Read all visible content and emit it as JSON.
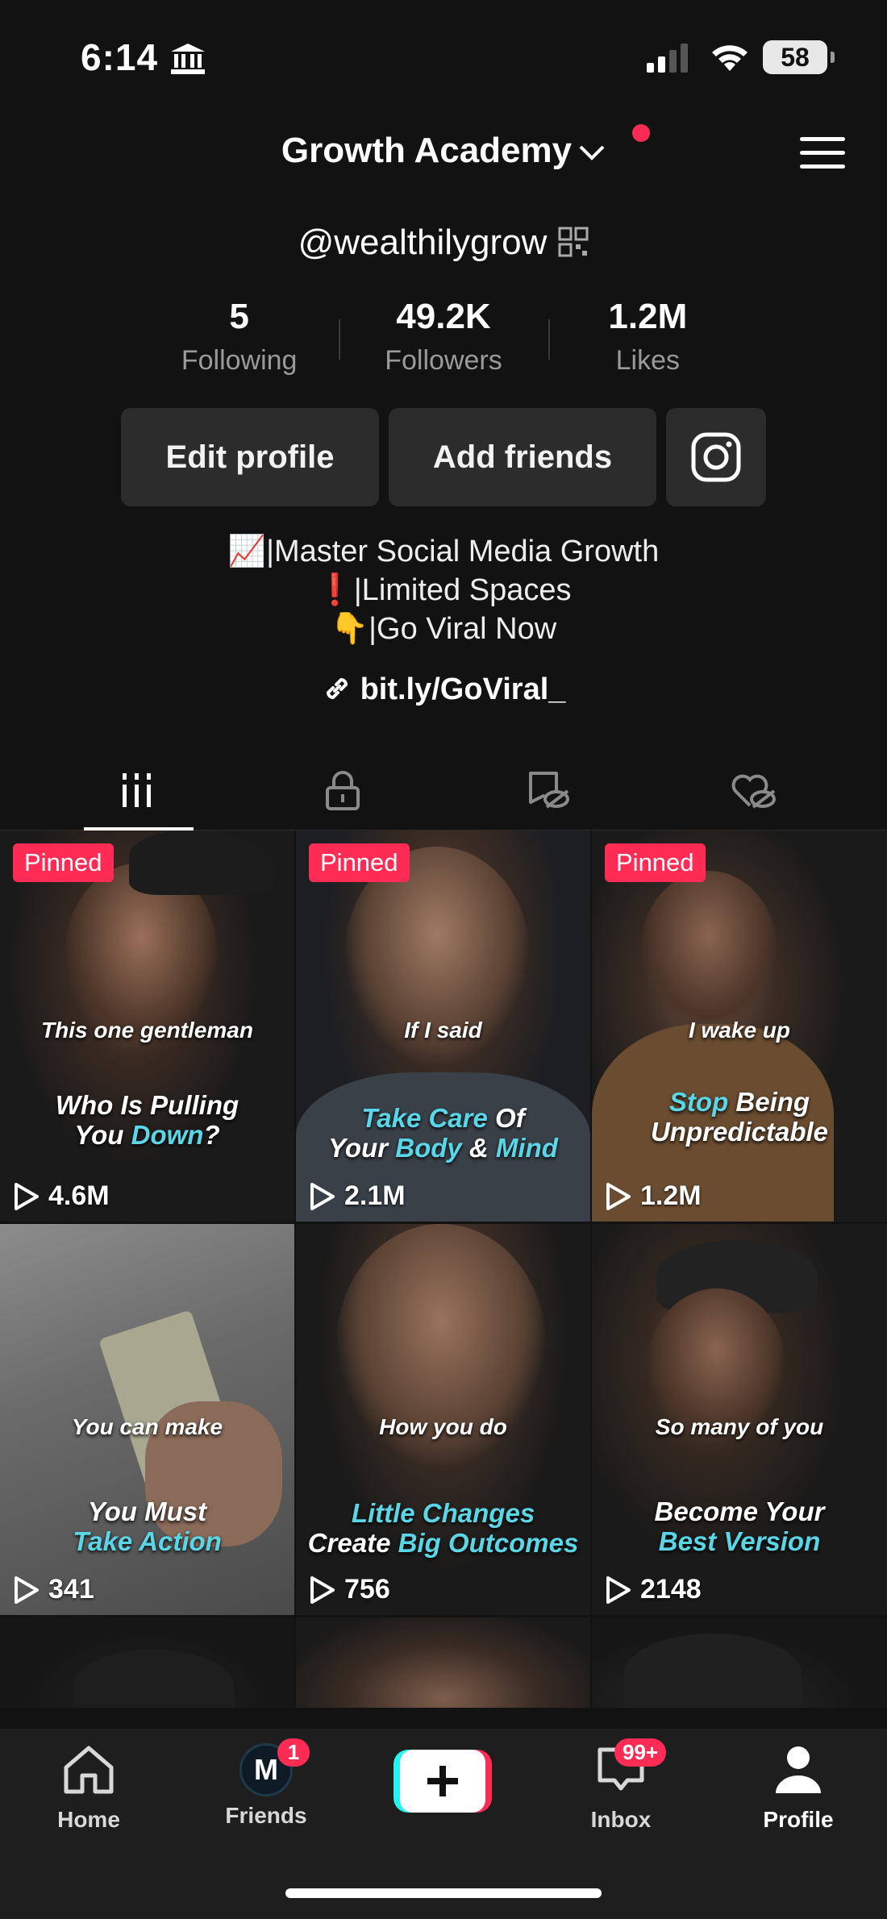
{
  "status_bar": {
    "time": "6:14",
    "battery": "58"
  },
  "header": {
    "account_name": "Growth Academy",
    "handle": "@wealthilygrow"
  },
  "stats": [
    {
      "value": "5",
      "label": "Following"
    },
    {
      "value": "49.2K",
      "label": "Followers"
    },
    {
      "value": "1.2M",
      "label": "Likes"
    }
  ],
  "actions": {
    "edit_profile": "Edit profile",
    "add_friends": "Add friends"
  },
  "bio": {
    "line1_emoji": "📈",
    "line1": "|Master Social Media Growth",
    "line2_emoji": "❗",
    "line2": "|Limited Spaces",
    "line3_emoji": "👇",
    "line3": "|Go Viral Now",
    "link": "bit.ly/GoViral_"
  },
  "tabs": [
    "videos-icon",
    "lock-icon",
    "repost-eye-off-icon",
    "heart-eye-off-icon"
  ],
  "videos": [
    {
      "pinned": "Pinned",
      "caption_top": "This one gentleman",
      "caption_line1": "Who Is Pulling",
      "caption_line2_a": "You ",
      "caption_line2_hl": "Down",
      "caption_line2_b": "?",
      "views": "4.6M"
    },
    {
      "pinned": "Pinned",
      "caption_top": "If I said",
      "caption_line1_hl": "Take Care",
      "caption_line1": " Of",
      "caption_line2_a": "Your ",
      "caption_line2_hl": "Body",
      "caption_line2_b": " & ",
      "caption_line2_hl2": "Mind",
      "views": "2.1M"
    },
    {
      "pinned": "Pinned",
      "caption_top": "I wake up",
      "caption_line1_hl": "Stop",
      "caption_line1": " Being",
      "caption_line2": "Unpredictable",
      "views": "1.2M"
    },
    {
      "caption_top": "You can make",
      "caption_line1": "You Must",
      "caption_line2_hl": "Take Action",
      "views": "341"
    },
    {
      "caption_top": "How you do",
      "caption_line1_hl": "Little Changes",
      "caption_line2_a": "Create ",
      "caption_line2_hl": "Big Outcomes",
      "views": "756"
    },
    {
      "caption_top": "So many of you",
      "caption_line1": "Become Your",
      "caption_line2_hl": "Best Version",
      "views": "2148"
    }
  ],
  "bottom_nav": {
    "home": "Home",
    "friends": "Friends",
    "friends_badge": "1",
    "inbox": "Inbox",
    "inbox_badge": "99+",
    "profile": "Profile"
  },
  "colors": {
    "accent": "#fe2c55",
    "caption_highlight": "#5ad6e6",
    "background": "#121212"
  }
}
